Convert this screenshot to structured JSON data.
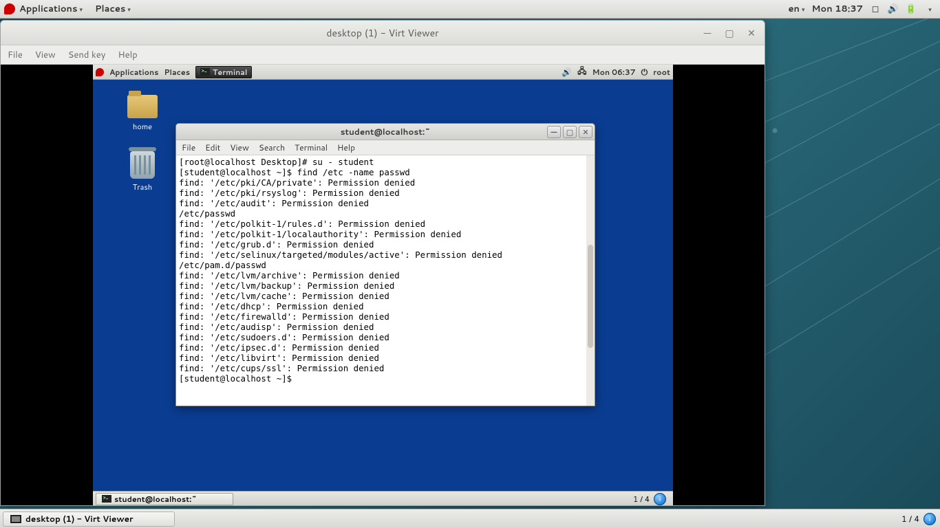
{
  "host_panel": {
    "applications": "Applications",
    "places": "Places",
    "lang": "en",
    "clock": "Mon 18:37"
  },
  "host_bottom": {
    "task_label": "desktop (1) - Virt Viewer",
    "workspace": "1 / 4"
  },
  "vv": {
    "title": "desktop (1) - Virt Viewer",
    "menu": {
      "file": "File",
      "view": "View",
      "sendkey": "Send key",
      "help": "Help"
    }
  },
  "guest_panel": {
    "applications": "Applications",
    "places": "Places",
    "task": "Terminal",
    "clock": "Mon 06:37",
    "user": "root"
  },
  "guest_icons": {
    "home": "home",
    "trash": "Trash"
  },
  "guest_bottom": {
    "task_label": "student@localhost:~",
    "workspace": "1 / 4"
  },
  "terminal": {
    "title": "student@localhost:~",
    "menu": {
      "file": "File",
      "edit": "Edit",
      "view": "View",
      "search": "Search",
      "terminal": "Terminal",
      "help": "Help"
    },
    "lines": [
      "[root@localhost Desktop]# su - student",
      "[student@localhost ~]$ find /etc -name passwd",
      "find: '/etc/pki/CA/private': Permission denied",
      "find: '/etc/pki/rsyslog': Permission denied",
      "find: '/etc/audit': Permission denied",
      "/etc/passwd",
      "find: '/etc/polkit-1/rules.d': Permission denied",
      "find: '/etc/polkit-1/localauthority': Permission denied",
      "find: '/etc/grub.d': Permission denied",
      "find: '/etc/selinux/targeted/modules/active': Permission denied",
      "/etc/pam.d/passwd",
      "find: '/etc/lvm/archive': Permission denied",
      "find: '/etc/lvm/backup': Permission denied",
      "find: '/etc/lvm/cache': Permission denied",
      "find: '/etc/dhcp': Permission denied",
      "find: '/etc/firewalld': Permission denied",
      "find: '/etc/audisp': Permission denied",
      "find: '/etc/sudoers.d': Permission denied",
      "find: '/etc/ipsec.d': Permission denied",
      "find: '/etc/libvirt': Permission denied",
      "find: '/etc/cups/ssl': Permission denied",
      "[student@localhost ~]$ "
    ]
  }
}
